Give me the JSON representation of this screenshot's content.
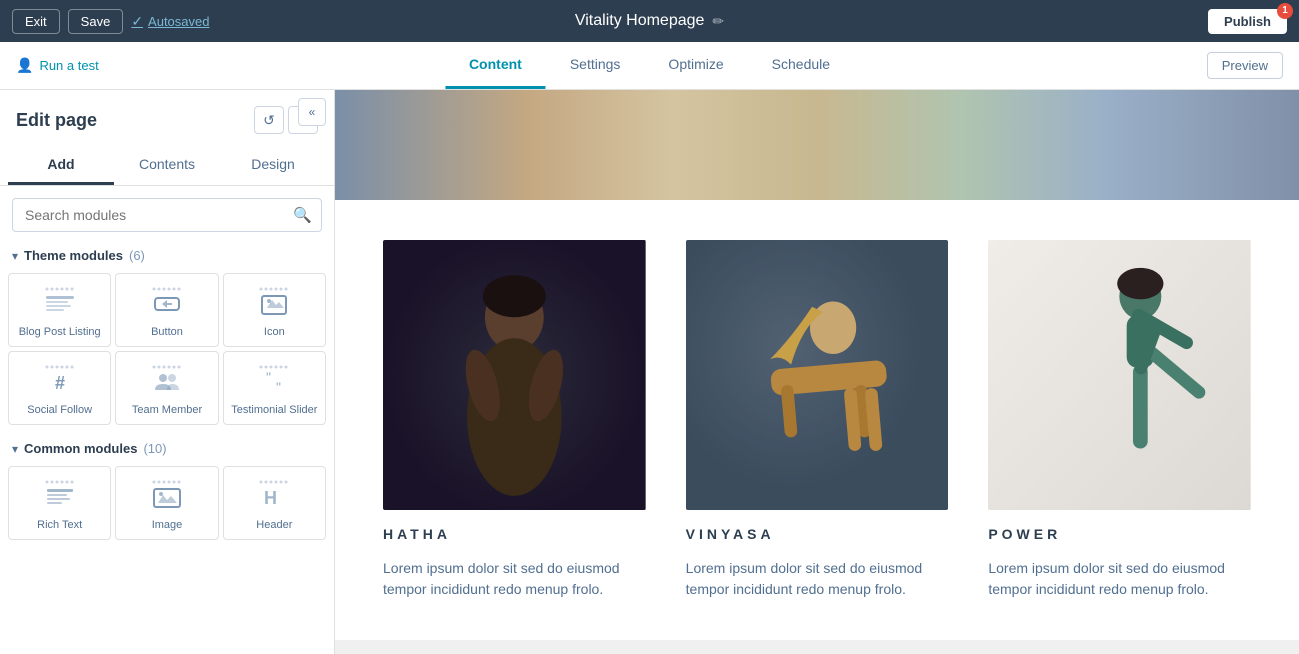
{
  "topbar": {
    "exit_label": "Exit",
    "save_label": "Save",
    "autosaved_label": "Autosaved",
    "page_title": "Vitality Homepage",
    "publish_label": "Publish",
    "publish_badge": "1"
  },
  "navbar": {
    "run_test_label": "Run a test",
    "tabs": [
      {
        "id": "content",
        "label": "Content",
        "active": true
      },
      {
        "id": "settings",
        "label": "Settings",
        "active": false
      },
      {
        "id": "optimize",
        "label": "Optimize",
        "active": false
      },
      {
        "id": "schedule",
        "label": "Schedule",
        "active": false
      }
    ],
    "preview_label": "Preview"
  },
  "sidebar": {
    "edit_page_title": "Edit page",
    "tabs": [
      {
        "id": "add",
        "label": "Add",
        "active": true
      },
      {
        "id": "contents",
        "label": "Contents",
        "active": false
      },
      {
        "id": "design",
        "label": "Design",
        "active": false
      }
    ],
    "search_placeholder": "Search modules",
    "theme_section": {
      "title": "Theme modules",
      "count": "(6)",
      "modules": [
        {
          "id": "blog-post-listing",
          "label": "Blog Post Listing",
          "icon": "list-icon"
        },
        {
          "id": "button",
          "label": "Button",
          "icon": "button-icon"
        },
        {
          "id": "icon",
          "label": "Icon",
          "icon": "icon-icon"
        },
        {
          "id": "social-follow",
          "label": "Social Follow",
          "icon": "hashtag-icon"
        },
        {
          "id": "team-member",
          "label": "Team Member",
          "icon": "team-icon"
        },
        {
          "id": "testimonial-slider",
          "label": "Testimonial Slider",
          "icon": "quote-icon"
        }
      ]
    },
    "common_section": {
      "title": "Common modules",
      "count": "(10)",
      "modules": [
        {
          "id": "rich-text",
          "label": "Rich Text",
          "icon": "text-icon"
        },
        {
          "id": "image",
          "label": "Image",
          "icon": "image-icon"
        },
        {
          "id": "header",
          "label": "Header",
          "icon": "header-icon"
        }
      ]
    }
  },
  "content": {
    "classes": [
      {
        "id": "hatha",
        "name": "HATHA",
        "description": "Lorem ipsum dolor sit sed do eiusmod tempor incididunt redo menup frolo.",
        "image_type": "hatha"
      },
      {
        "id": "vinyasa",
        "name": "VINYASA",
        "description": "Lorem ipsum dolor sit sed do eiusmod tempor incididunt redo menup frolo.",
        "image_type": "vinyasa"
      },
      {
        "id": "power",
        "name": "POWER",
        "description": "Lorem ipsum dolor sit sed do eiusmod tempor incididunt redo menup frolo.",
        "image_type": "power"
      }
    ]
  }
}
